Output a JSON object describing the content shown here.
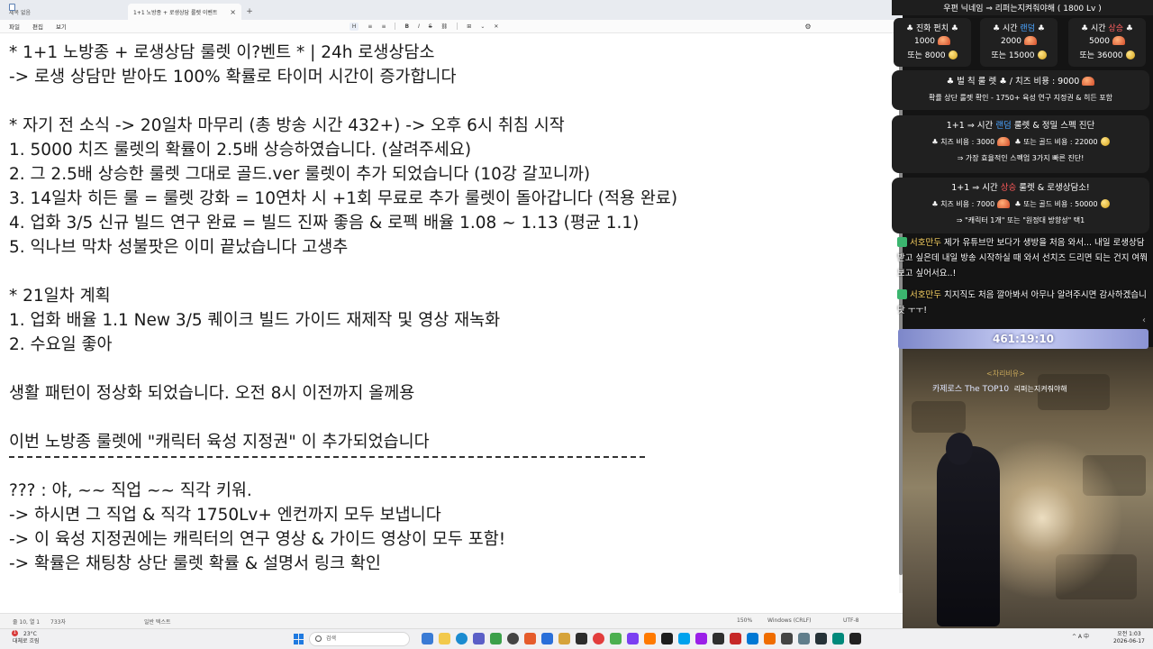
{
  "notepad": {
    "tabs": [
      {
        "label": "제목 없음"
      },
      {
        "label": "1+1 노방종 + 로생상담 룰렛 이벤트"
      }
    ],
    "new_tab": "+",
    "close_glyph": "×",
    "menu": [
      "파일",
      "편집",
      "보기"
    ],
    "format_toolbar": [
      "H",
      "≡",
      "≡",
      "B",
      "I",
      "S",
      "⛓",
      "⊞",
      "⌄",
      "✕"
    ],
    "settings_glyph": "⚙",
    "lines": [
      "* 1+1 노방종 + 로생상담 룰렛 이?벤트 * | 24h 로생상담소",
      "-> 로생 상담만 받아도 100% 확률로 타이머 시간이 증가합니다",
      "",
      "* 자기 전 소식 -> 20일차 마무리 (총 방송 시간 432+) -> 오후 6시 취침 시작",
      "1. 5000 치즈 룰렛의 확률이 2.5배 상승하였습니다. (살려주세요)",
      "2. 그 2.5배 상승한 룰렛 그대로 골드.ver 룰렛이 추가 되었습니다 (10강 갈꼬니까)",
      "3. 14일차 히든 룰 = 룰렛 강화 = 10연차 시 +1회 무료로 추가 룰렛이 돌아갑니다 (적용 완료)",
      "4. 업화 3/5 신규 빌드 연구 완료 = 빌드 진짜 좋음 & 로펙 배율 1.08 ~ 1.13 (평균 1.1)",
      "5. 익나브 막차 성불팟은 이미 끝났습니다 고생추",
      "",
      "* 21일차 계획",
      "1. 업화 배율 1.1 New 3/5 퀘이크 빌드 가이드 재제작 및 영상 재녹화",
      "2. 수요일 좋아",
      "",
      "생활 패턴이 정상화 되었습니다. 오전 8시 이전까지 올께용",
      "",
      "이번 노방종 룰렛에 \"캐릭터 육성 지정권\" 이 추가되었습니다",
      "",
      "??? : 야, ~~ 직업 ~~ 직각 키워.",
      "-> 하시면 그 직업 & 직각 1750Lv+ 엔컨까지 모두 보냅니다",
      "-> 이 육성 지정권에는 캐릭터의 연구 영상 & 가이드 영상이 모두 포함!",
      "-> 확률은 채팅창 상단 룰렛 확률 & 설명서 링크 확인"
    ],
    "status": {
      "position": "줄 10, 열 1",
      "chars": "733자",
      "mode": "일반 텍스트",
      "zoom": "150%",
      "eol": "Windows (CRLF)",
      "encoding": "UTF-8"
    }
  },
  "stream": {
    "top_banner": "우편 닉네임 ⇒ 리퍼는지켜줘야해 ( 1800 Lv )",
    "boxes": [
      {
        "title": "♣ 진화 펀치 ♣",
        "cheese": "1000",
        "gold": "또는 8000"
      },
      {
        "title_pre": "♣ 시간 ",
        "title_hl": "랜덤",
        "title_post": " ♣",
        "cheese": "2000",
        "gold": "또는 15000"
      },
      {
        "title_pre": "♣ 시간 ",
        "title_hl": "상승",
        "title_post": " ♣",
        "cheese": "5000",
        "gold": "또는 36000"
      }
    ],
    "card1": {
      "line1": "♣ 벌 칙 룰 렛 ♣ / 치즈 비용 : 9000",
      "line2": "확률 상단 룰렛 확인 - 1750+ 육성 연구 지정권 & 히든 포함"
    },
    "card2": {
      "line1_pre": "1+1 ⇒ 시간 ",
      "line1_hl": "랜덤",
      "line1_post": " 룰렛 & 정밀 스펙 진단",
      "line2_a": "♣ 치즈 비용 : 3000",
      "line2_b": "♣ 또는 골드 비용 : 22000",
      "line3": "⇒ 가장 효율적인 스펙업 3가지 빠른 진단!"
    },
    "card3": {
      "line1_pre": "1+1 ⇒ 시간 ",
      "line1_hl": "상승",
      "line1_post": " 룰렛 & 로생상담소!",
      "line2_a": "♣ 치즈 비용 : 7000",
      "line2_b": "♣ 또는 골드 비용 : 50000",
      "line3": "⇒ \"캐릭터 1개\" 또는 \"원정대 방향성\" 택1"
    },
    "chat": [
      {
        "nick": "서호만두",
        "text": "제가 유튜브만 보다가 생방을 처음 와서... 내일 로생상담 받고 싶은데 내일 방송 시작하실 때 와서 선치즈 드리면 되는 건지 여쭤보고 싶어서요..!"
      },
      {
        "nick": "서호만두",
        "text": "치지직도 처음 깔아봐서 아무나 알려주시면 감사하겠습니닷 ㅜㅜ!"
      }
    ],
    "timer": "461:19:10",
    "rank_label": "<차리비유>",
    "player_title": "카제로스 The TOP10",
    "player_name": "리퍼는지켜줘야해"
  },
  "taskbar": {
    "weather_temp": "23°C",
    "weather_desc": "대체로 흐림",
    "badge": "1",
    "search_placeholder": "검색",
    "clock_time": "오전 1:03",
    "clock_date": "2026-06-17",
    "tray": "^ A 中"
  },
  "colors": {
    "accent_blue": "#4aa3ff",
    "accent_red": "#ff5a5a",
    "timer_bar": "#9aa2e0",
    "editor_bg": "#ffffff"
  },
  "icons": [
    "notepad-icon",
    "close-icon",
    "search-icon",
    "windows-start-icon",
    "cheese-icon",
    "gold-coin-icon",
    "gear-icon"
  ]
}
